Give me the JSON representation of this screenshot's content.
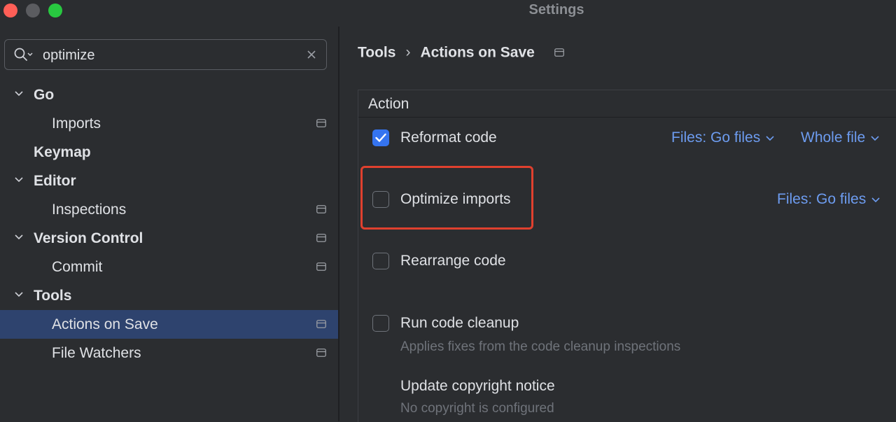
{
  "window": {
    "title": "Settings"
  },
  "search": {
    "value": "optimize"
  },
  "sidebar": {
    "items": [
      {
        "label": "Go",
        "level": "parent",
        "expanded": true,
        "project_icon": false,
        "selected": false
      },
      {
        "label": "Imports",
        "level": "child",
        "project_icon": true,
        "selected": false
      },
      {
        "label": "Keymap",
        "level": "parent",
        "expanded": null,
        "project_icon": false,
        "selected": false
      },
      {
        "label": "Editor",
        "level": "parent",
        "expanded": true,
        "project_icon": false,
        "selected": false
      },
      {
        "label": "Inspections",
        "level": "child",
        "project_icon": true,
        "selected": false
      },
      {
        "label": "Version Control",
        "level": "parent",
        "expanded": true,
        "project_icon": true,
        "selected": false
      },
      {
        "label": "Commit",
        "level": "child",
        "project_icon": true,
        "selected": false
      },
      {
        "label": "Tools",
        "level": "parent",
        "expanded": true,
        "project_icon": false,
        "selected": false
      },
      {
        "label": "Actions on Save",
        "level": "child",
        "project_icon": true,
        "selected": true
      },
      {
        "label": "File Watchers",
        "level": "child",
        "project_icon": true,
        "selected": false
      }
    ]
  },
  "breadcrumb": {
    "parent": "Tools",
    "separator": "›",
    "current": "Actions on Save"
  },
  "table": {
    "header": "Action",
    "rows": [
      {
        "label": "Reformat code",
        "checked": true,
        "files_dropdown": "Files: Go files",
        "scope_dropdown": "Whole file"
      },
      {
        "label": "Optimize imports",
        "checked": false,
        "files_dropdown": "Files: Go files"
      },
      {
        "label": "Rearrange code",
        "checked": false
      },
      {
        "label": "Run code cleanup",
        "checked": false,
        "description": "Applies fixes from the code cleanup inspections"
      },
      {
        "label": "Update copyright notice",
        "description": "No copyright is configured"
      }
    ]
  },
  "colors": {
    "accent": "#3574f0",
    "link": "#6d9cf0",
    "selection": "#2e436e",
    "highlight_box": "#e0402e"
  }
}
